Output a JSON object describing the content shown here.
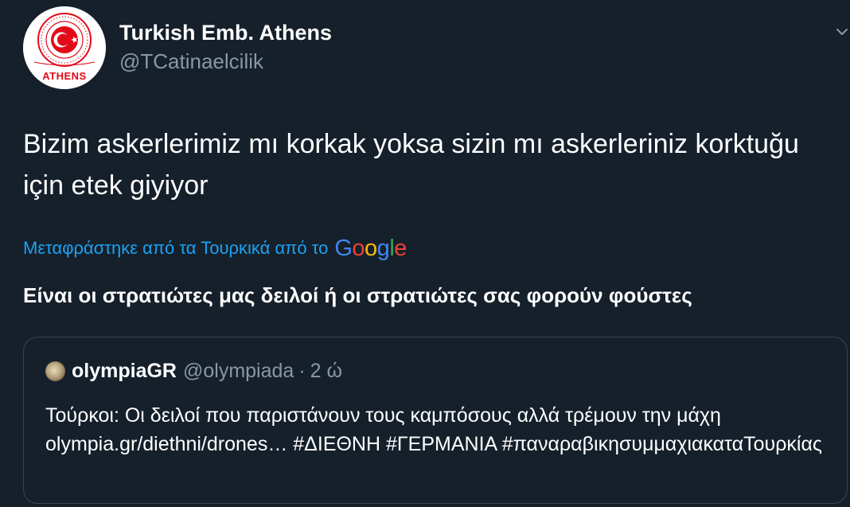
{
  "tweet": {
    "author": {
      "name": "Turkish Emb. Athens",
      "handle": "@TCatinaelcilik",
      "avatar_label": "ATHENS"
    },
    "text": "Bizim askerlerimiz mı korkak yoksa sizin mı askerleriniz korktuğu için etek giyiyor",
    "translation_label": "Μεταφράστηκε από τα Τουρκικά από το",
    "translation_provider": {
      "letters": [
        "G",
        "o",
        "o",
        "g",
        "l",
        "e"
      ],
      "colors": [
        "#4285f4",
        "#ea4335",
        "#fbbc05",
        "#4285f4",
        "#34a853",
        "#ea4335"
      ]
    },
    "translation": "Είναι οι στρατιώτες μας δειλοί ή οι στρατιώτες σας φορούν φούστες",
    "menu_icon": "chevron-down-icon"
  },
  "quoted_tweet": {
    "name": "olympiaGR",
    "handle": "@olympiada",
    "separator": "·",
    "time": "2 ώ",
    "text": "Τούρκοι: Οι δειλοί που παριστάνουν τους καμπόσους αλλά τρέμουν την μάχη olympia.gr/diethni/drones… #ΔΙΕΘΝΗ #ΓΕΡΜΑΝΙΑ #παναραβικησυμμαχιακαταΤουρκίας"
  },
  "colors": {
    "background": "#15202b",
    "text_primary": "#ffffff",
    "text_secondary": "#8899a6",
    "link": "#1da1f2",
    "border": "#38444d",
    "flag_red": "#e30a17"
  }
}
